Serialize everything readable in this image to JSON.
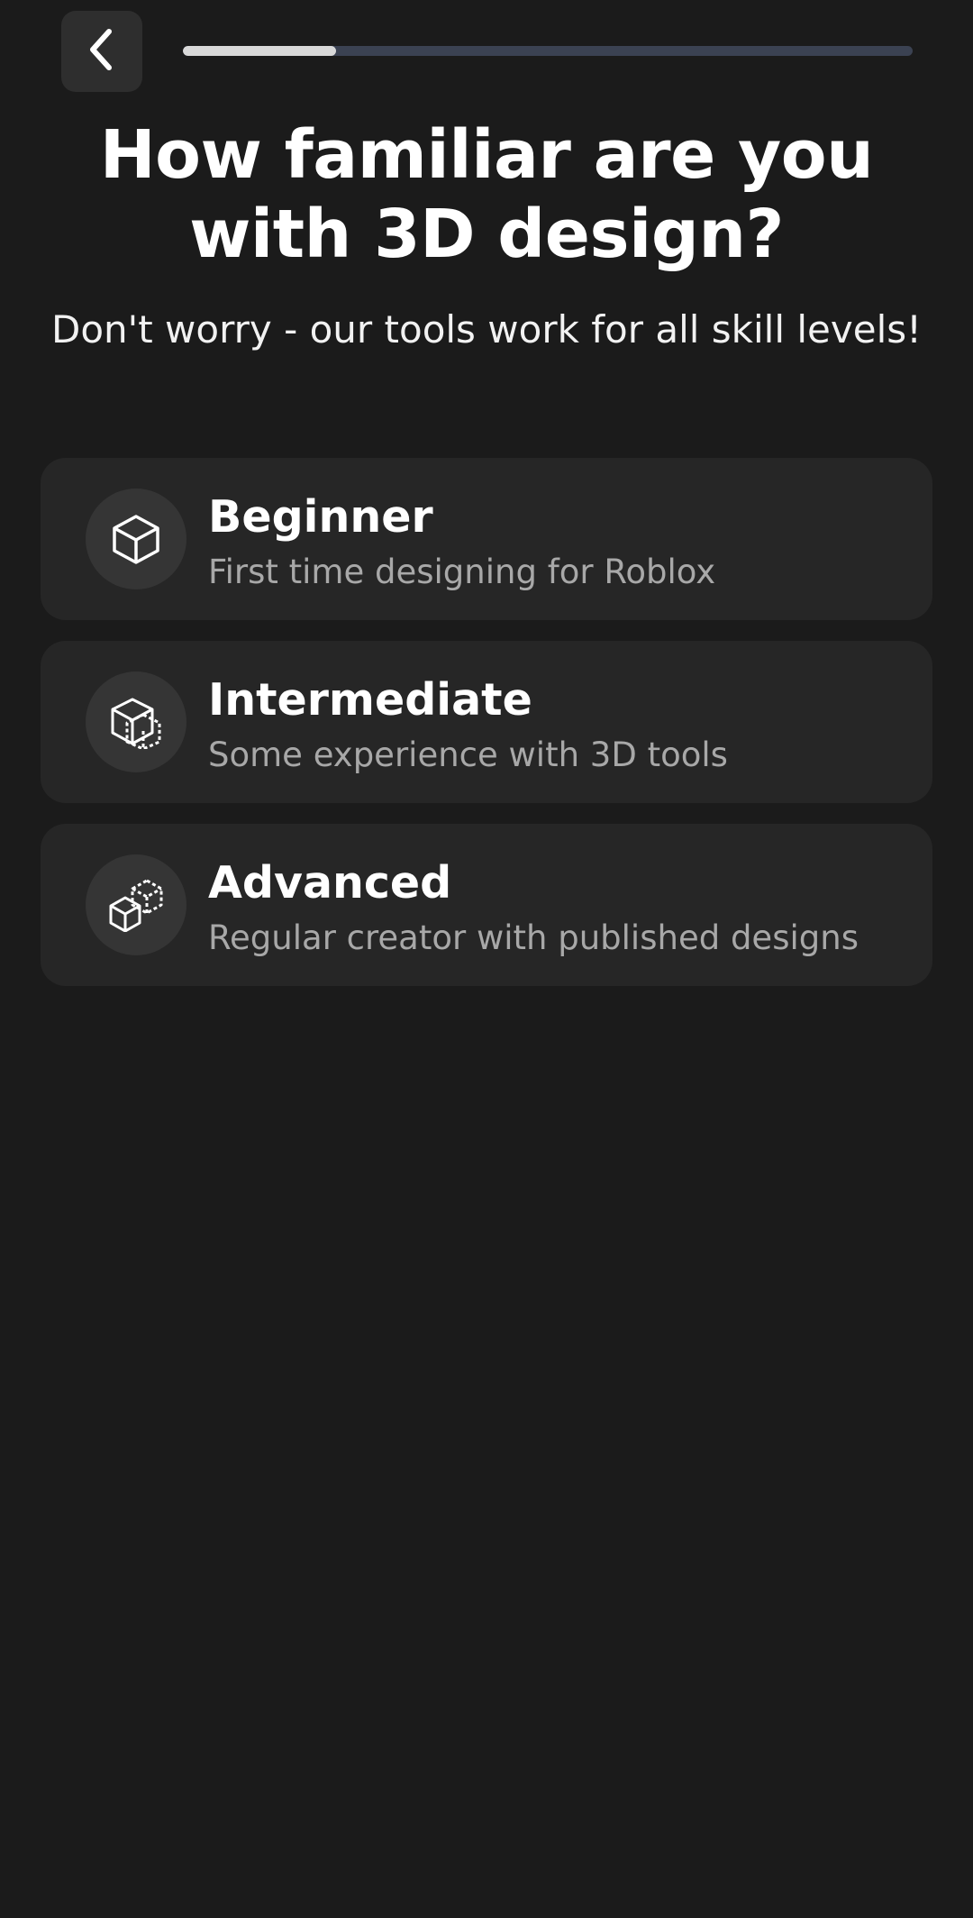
{
  "header": {
    "back_icon": "chevron-left-icon",
    "progress_fraction": 0.21,
    "progress_colors": {
      "fill": "#d9d9d9",
      "track": "#3b4252"
    }
  },
  "title": "How familiar are you with 3D design?",
  "subtitle": "Don't worry - our tools work for all skill levels!",
  "options": [
    {
      "title": "Beginner",
      "description": "First time designing for Roblox",
      "icon": "cube-icon"
    },
    {
      "title": "Intermediate",
      "description": "Some experience with 3D tools",
      "icon": "cube-dashed-icon"
    },
    {
      "title": "Advanced",
      "description": "Regular creator with published designs",
      "icon": "cubes-icon"
    }
  ],
  "colors": {
    "background": "#1b1b1b",
    "card": "#262626",
    "icon_circle": "#353535",
    "secondary_text": "#a8a8a8"
  }
}
